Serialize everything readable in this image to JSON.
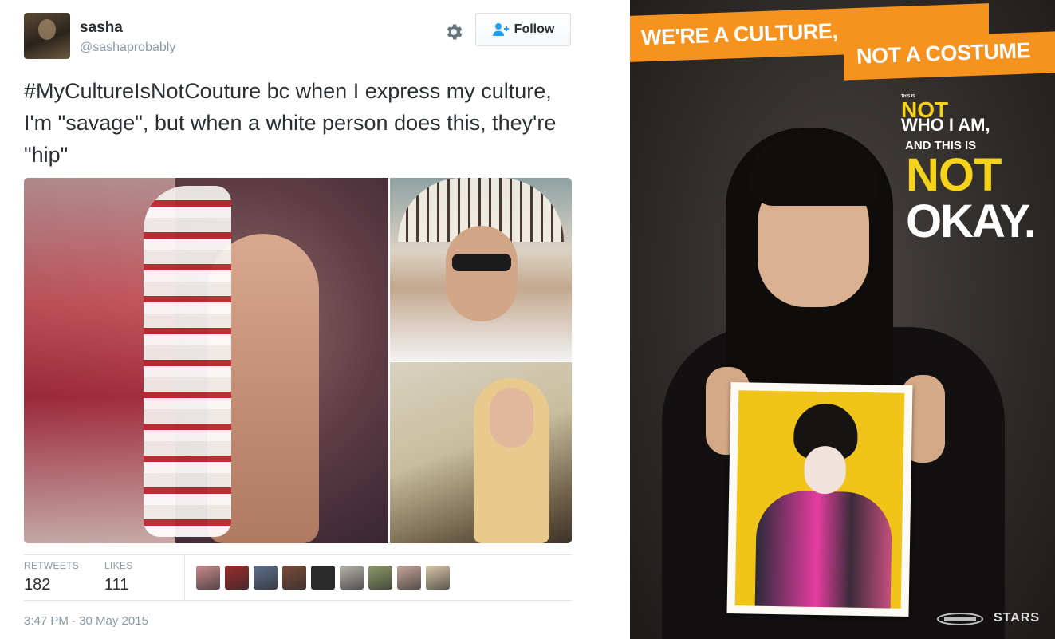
{
  "tweet": {
    "display_name": "sasha",
    "handle": "@sashaprobably",
    "follow_label": "Follow",
    "text_hashtag": "#MyCultureIsNotCouture",
    "text_body": " bc when I express my culture, I'm \"savage\", but when a white person does this, they're \"hip\"",
    "retweets_label": "RETWEETS",
    "retweets_value": "182",
    "likes_label": "LIKES",
    "likes_value": "111",
    "liker_colors": [
      "#c98a8e",
      "#9b2b2b",
      "#5d6f8c",
      "#7a4b38",
      "#2a2a2a",
      "#b7b3ab",
      "#8e9a6a",
      "#c6a49a",
      "#d8c7a8"
    ],
    "timestamp": "3:47 PM - 30 May 2015",
    "icons": {
      "settings": "gear-icon",
      "follow": "add-person-icon"
    }
  },
  "poster": {
    "banner_line1": "WE'RE A CULTURE,",
    "banner_line2": "NOT A COSTUME",
    "small_text": "THIS IS",
    "not_line1": "NOT",
    "who_line": "WHO I AM,",
    "and_this_line": "AND THIS IS",
    "not_line2": "NOT",
    "okay_line": "OKAY.",
    "logo_text": "STARS",
    "accent_orange": "#f6921e",
    "accent_yellow": "#f5d31a"
  }
}
